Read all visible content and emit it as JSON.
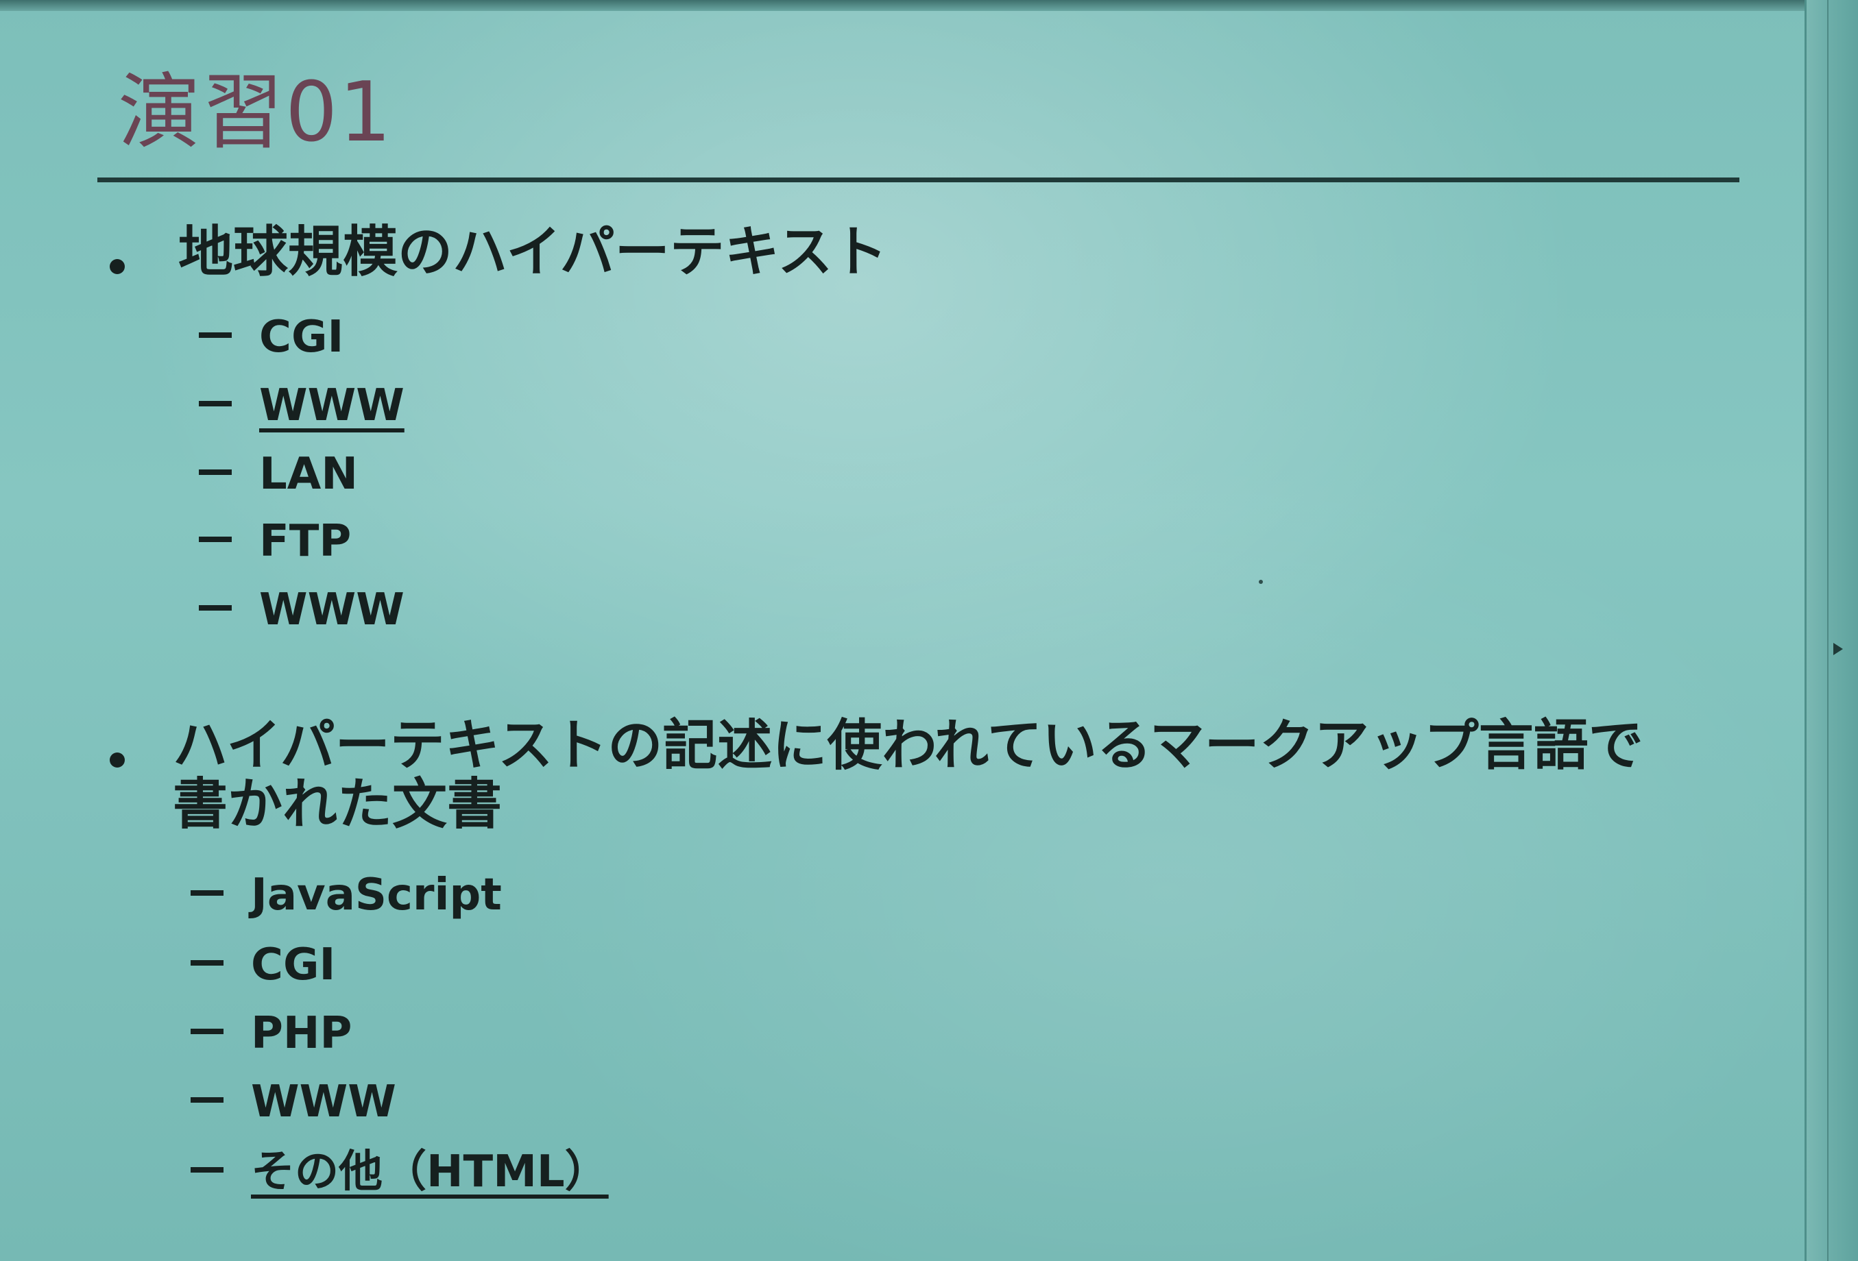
{
  "slide": {
    "title": "演習01",
    "sections": [
      {
        "question": "地球規模のハイパーテキスト",
        "options": [
          {
            "label": "CGI",
            "underlined": false
          },
          {
            "label": "WWW",
            "underlined": true
          },
          {
            "label": "LAN",
            "underlined": false
          },
          {
            "label": "FTP",
            "underlined": false
          },
          {
            "label": "WWW",
            "underlined": false
          }
        ]
      },
      {
        "question_line1": "ハイパーテキストの記述に使われているマークアップ言語で",
        "question_line2": "書かれた文書",
        "options": [
          {
            "label": "JavaScript",
            "underlined": false
          },
          {
            "label": "CGI",
            "underlined": false
          },
          {
            "label": "PHP",
            "underlined": false
          },
          {
            "label": "WWW",
            "underlined": false
          },
          {
            "label": "その他（HTML）",
            "underlined": true
          }
        ]
      }
    ]
  },
  "colors": {
    "background": "#86c6c1",
    "title": "#6a4454",
    "text": "#16201f",
    "rule": "#1f3a38"
  }
}
